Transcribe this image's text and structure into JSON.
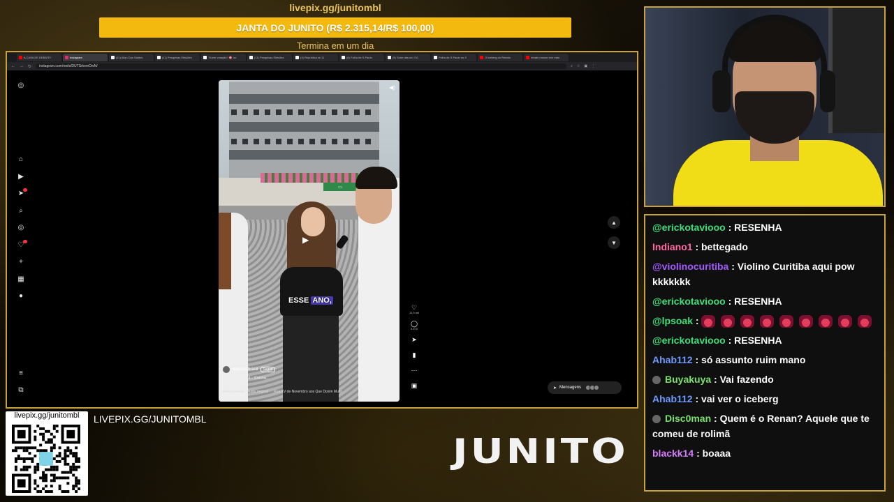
{
  "goal": {
    "url": "livepix.gg/junitombl",
    "bar_text": "JANTA DO JUNITO (R$ 2.315,14/R$ 100,00)",
    "subtitle": "Termina em um dia",
    "color": "#f4b90f"
  },
  "browser": {
    "tabs": [
      {
        "label": "A CASA DE DEBATE!",
        "icon": "youtube-icon",
        "active": false
      },
      {
        "label": "Instagram",
        "icon": "instagram-icon",
        "active": true
      },
      {
        "label": "(11) Allan Dos Santos",
        "icon": "x-icon",
        "active": false
      },
      {
        "label": "(11) Pesquisas Eleições",
        "icon": "x-icon",
        "active": false
      },
      {
        "label": "Tá em votação? 🎯 no",
        "icon": "x-icon",
        "active": false
      },
      {
        "label": "(11) Pesquisas Eleições",
        "icon": "x-icon",
        "active": false
      },
      {
        "label": "(4) República se 11",
        "icon": "x-icon",
        "active": false
      },
      {
        "label": "(6) Folha de S.Paulo",
        "icon": "x-icon",
        "active": false
      },
      {
        "label": "(5) Sobe das um 7x1",
        "icon": "x-icon",
        "active": false
      },
      {
        "label": "Folha de S.Paulo no X",
        "icon": "x-icon",
        "active": false
      },
      {
        "label": "O iceberg do Renato",
        "icon": "youtube-icon",
        "active": false
      },
      {
        "label": "renato mouse iron man",
        "icon": "youtube-icon",
        "active": false
      }
    ],
    "url": "instagram.com/reels/DUTSrkemOwN/"
  },
  "instagram": {
    "caption_word1": "ESSE",
    "caption_word2": "ANO,",
    "username": "eleicoesbrasil",
    "follow_label": "Seguir",
    "description": "Eleições Brasil - Sonho...",
    "audio": "eleicoesbrasil · Áudio original",
    "location": "Rua XV de Novembro aos Que Dizem Muito",
    "likes": "11,9 mil",
    "comments": "5.470",
    "messages_label": "Mensagens",
    "messages_badge": "9+",
    "notif_badge": "9+"
  },
  "overlay": {
    "qr_label": "livepix.gg/junitombl",
    "livepix_text": "LIVEPIX.GG/JUNITOMBL",
    "logo": "JUNITO"
  },
  "chat": [
    {
      "user": "@erickotaviooo",
      "color": "#3ee07a",
      "text": ": RESENHA",
      "badge": false
    },
    {
      "user": "Indiano1",
      "color": "#ff6aa2",
      "text": ": bettegado",
      "badge": false
    },
    {
      "user": "@violinocuritiba",
      "color": "#a35cff",
      "text": ": Violino Curitiba aqui pow kkkkkkk",
      "badge": false
    },
    {
      "user": "@erickotaviooo",
      "color": "#3ee07a",
      "text": ": RESENHA",
      "badge": false
    },
    {
      "user": "@lpsoak",
      "color": "#3ee07a",
      "text": ":",
      "emotes": 9,
      "badge": false
    },
    {
      "user": "@erickotaviooo",
      "color": "#3ee07a",
      "text": ": RESENHA",
      "badge": false
    },
    {
      "user": "Ahab112",
      "color": "#6f9bff",
      "text": ": só assunto ruim mano",
      "badge": false
    },
    {
      "user": "Buyakuya",
      "color": "#7be36b",
      "text": ": Vai fazendo",
      "badge": true
    },
    {
      "user": "Ahab112",
      "color": "#6f9bff",
      "text": ": vai ver o iceberg",
      "badge": false
    },
    {
      "user": "Disc0man",
      "color": "#7be36b",
      "text": ": Quem é o Renan? Aquele que te comeu de rolimã",
      "badge": true
    },
    {
      "user": "blackk14",
      "color": "#d77bff",
      "text": ": boaaa",
      "badge": false
    }
  ]
}
